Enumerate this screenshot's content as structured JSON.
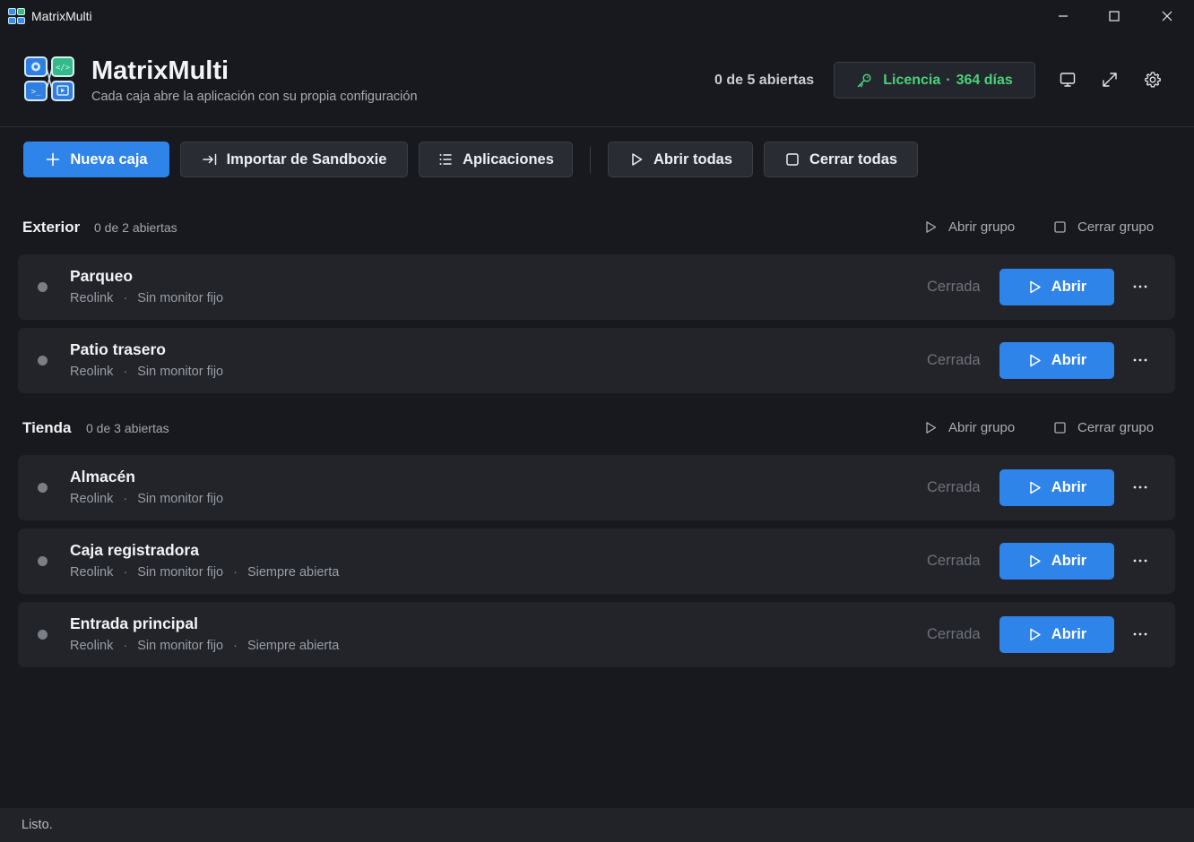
{
  "window": {
    "title": "MatrixMulti"
  },
  "header": {
    "title": "MatrixMulti",
    "subtitle": "Cada caja abre la aplicación con su propia configuración",
    "open_count": "0 de 5 abiertas",
    "license_label": "Licencia",
    "license_sep": "·",
    "license_days": "364 días"
  },
  "toolbar": {
    "new_box": "Nueva caja",
    "import": "Importar de Sandboxie",
    "apps": "Aplicaciones",
    "open_all": "Abrir todas",
    "close_all": "Cerrar todas"
  },
  "groups": [
    {
      "name": "Exterior",
      "count": "0 de 2 abiertas",
      "open_group": "Abrir grupo",
      "close_group": "Cerrar grupo",
      "boxes": [
        {
          "name": "Parqueo",
          "app": "Reolink",
          "monitor": "Sin monitor fijo",
          "state": "Cerrada",
          "action": "Abrir"
        },
        {
          "name": "Patio trasero",
          "app": "Reolink",
          "monitor": "Sin monitor fijo",
          "state": "Cerrada",
          "action": "Abrir"
        }
      ]
    },
    {
      "name": "Tienda",
      "count": "0 de 3 abiertas",
      "open_group": "Abrir grupo",
      "close_group": "Cerrar grupo",
      "boxes": [
        {
          "name": "Almacén",
          "app": "Reolink",
          "monitor": "Sin monitor fijo",
          "state": "Cerrada",
          "action": "Abrir"
        },
        {
          "name": "Caja registradora",
          "app": "Reolink",
          "monitor": "Sin monitor fijo",
          "always": "Siempre abierta",
          "state": "Cerrada",
          "action": "Abrir"
        },
        {
          "name": "Entrada principal",
          "app": "Reolink",
          "monitor": "Sin monitor fijo",
          "always": "Siempre abierta",
          "state": "Cerrada",
          "action": "Abrir"
        }
      ]
    }
  ],
  "meta_sep": "·",
  "status": {
    "text": "Listo."
  },
  "colors": {
    "accent": "#2f84ea",
    "license_green": "#4bd07a",
    "background": "#18191e",
    "card": "#22242a"
  },
  "icons": {
    "minimize": "minimize-icon",
    "maximize": "maximize-icon",
    "close": "close-icon",
    "monitor": "monitor-icon",
    "expand": "expand-icon",
    "settings": "gear-icon",
    "license": "key-icon",
    "play": "play-icon",
    "stop": "square-icon"
  }
}
